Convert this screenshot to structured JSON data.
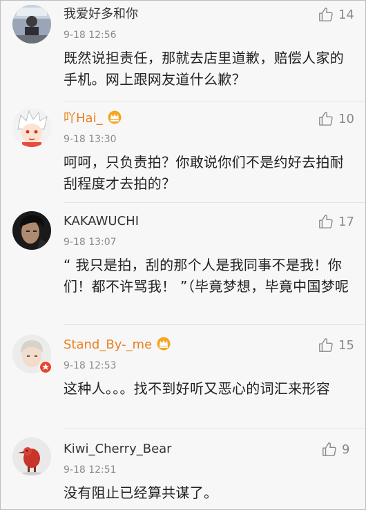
{
  "comments": [
    {
      "username": "我爱好多和你",
      "time": "9-18 12:56",
      "text": "既然说担责任，那就去店里道歉，赔偿人家的手机。网上跟网友道什么歉？",
      "likes": "14",
      "vip": false
    },
    {
      "username": "吖Hai_",
      "time": "9-18 13:30",
      "text": "呵呵，只负责拍？你敢说你们不是约好去拍耐刮程度才去拍的？",
      "likes": "10",
      "vip": true
    },
    {
      "username": "KAKAWUCHI",
      "time": "9-18 13:07",
      "text": "“ 我只是拍，刮的那个人是我同事不是我！你们！都不许骂我！ ”（毕竟梦想，毕竟中国梦呢",
      "likes": "17",
      "vip": false
    },
    {
      "username": "Stand_By-_me",
      "time": "9-18 12:53",
      "text": "这种人。。。找不到好听又恶心的词汇来形容",
      "likes": "15",
      "vip": true
    },
    {
      "username": "Kiwi_Cherry_Bear",
      "time": "9-18 12:51",
      "text": "没有阻止已经算共谋了。",
      "likes": "9",
      "vip": false
    }
  ],
  "colors": {
    "vip_name": "#eb7d1e",
    "crown": "#f5a623",
    "verified_badge": "#e8452c"
  },
  "icons": {
    "like": "thumbs-up-icon",
    "vip": "crown-icon",
    "verified": "verified-badge-icon"
  }
}
